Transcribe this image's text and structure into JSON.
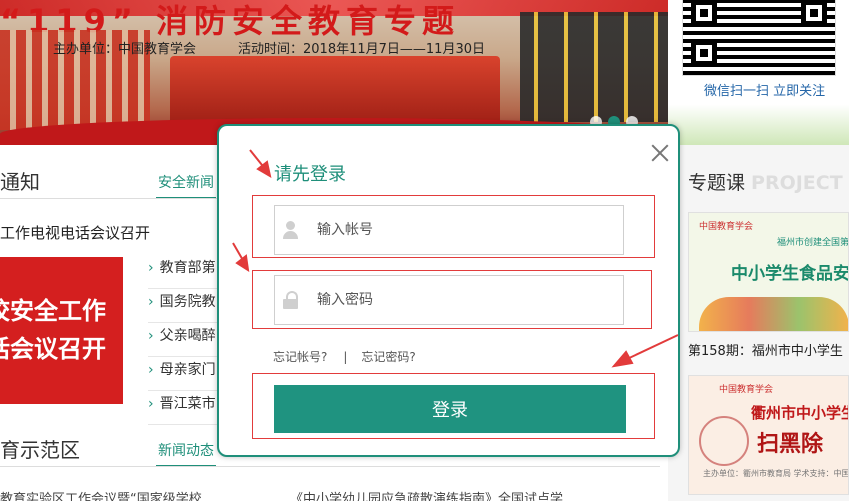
{
  "banner": {
    "title": "“119” 消防安全教育专题",
    "sponsor": "主办单位：中国教育学会",
    "activity_time": "活动时间：2018年11月7日——11月30日"
  },
  "qr": {
    "caption": "微信扫一扫  立即关注"
  },
  "left_sections": {
    "notice_head": "通知",
    "notice_tab": "安全新闻",
    "headline": "工作电视电话会议召开",
    "promo_line1": "校安全工作",
    "promo_line2": "话会议召开",
    "news": [
      "教育部第",
      "国务院教",
      "父亲喝醉",
      "母亲家门",
      "晋江菜市"
    ],
    "demo_head": "育示范区",
    "demo_tab": "新闻动态",
    "bottom_left": "教育实验区工作会议暨“国家级学校",
    "bottom_right": "《中小学幼儿园应急疏散演练指南》全国试点学"
  },
  "right_column": {
    "head": "专题课",
    "head_en": "PROJECT",
    "card1_logo": "中国教育学会",
    "card1_sub": "福州市创建全国第二批食",
    "card1_title": "中小学生食品安",
    "card1_caption": "第158期：福州市中小学生",
    "card2_logo": "中国教育学会",
    "card2_title": "衢州市中小学生",
    "card2_slogan": "扫黑除",
    "card2_footer": "主办单位：衢州市教育局  学术支持：中国教育学会"
  },
  "modal": {
    "title": "请先登录",
    "account_placeholder": "输入帐号",
    "password_placeholder": "输入密码",
    "forgot_account": "忘记帐号?",
    "separator": "|",
    "forgot_password": "忘记密码?",
    "login_label": "登录"
  },
  "colors": {
    "accent": "#1f8f7a",
    "annotation": "#e23b3b"
  }
}
